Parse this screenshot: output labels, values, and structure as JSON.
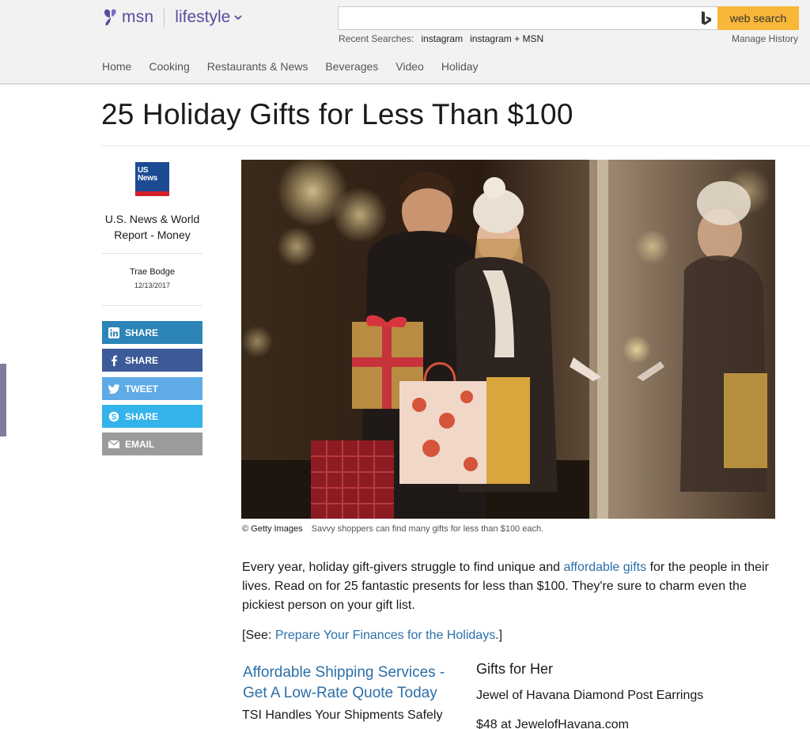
{
  "header": {
    "brand": "msn",
    "section": "lifestyle",
    "search": {
      "value": "",
      "placeholder": "",
      "button_label": "web search"
    },
    "recent_searches_label": "Recent Searches:",
    "recent_searches": [
      "instagram",
      "instagram + MSN"
    ],
    "manage_history": "Manage History"
  },
  "nav": [
    "Home",
    "Cooking",
    "Restaurants & News",
    "Beverages",
    "Video",
    "Holiday"
  ],
  "article": {
    "title": "25 Holiday Gifts for Less Than $100",
    "source": {
      "logo_text": "US News",
      "name": "U.S. News & World Report - Money"
    },
    "author": "Trae Bodge",
    "date": "12/13/2017",
    "image_credit": "© Getty Images",
    "image_caption": "Savvy shoppers can find many gifts for less than $100 each.",
    "intro": {
      "part1": "Every year, holiday gift-givers struggle to find unique and ",
      "link": "affordable gifts",
      "part2": " for the people in their lives. Read on for 25 fantastic presents for less than $100. They're sure to charm even the pickiest person on your gift list."
    },
    "see_prefix": "[See: ",
    "see_link": "Prepare Your Finances for the Holidays",
    "see_suffix": ".]"
  },
  "share_buttons": [
    {
      "label": "SHARE",
      "network": "linkedin"
    },
    {
      "label": "SHARE",
      "network": "facebook"
    },
    {
      "label": "TWEET",
      "network": "twitter"
    },
    {
      "label": "SHARE",
      "network": "skype"
    },
    {
      "label": "EMAIL",
      "network": "email"
    }
  ],
  "ad": {
    "title": "Affordable Shipping Services - Get A Low-Rate Quote Today",
    "description": "TSI Handles Your Shipments Safely"
  },
  "gifts_section": {
    "heading": "Gifts for Her",
    "item": "Jewel of Havana Diamond Post Earrings",
    "price_line": "$48 at JewelofHavana.com"
  },
  "colors": {
    "brand_purple": "#5a4b9e",
    "search_button": "#f8b739",
    "link_blue": "#2b6fa8",
    "linkedin": "#2c84b7",
    "facebook": "#3d5b99",
    "twitter": "#5eabe7",
    "skype": "#33b3ea",
    "email": "#9b9b9b"
  }
}
